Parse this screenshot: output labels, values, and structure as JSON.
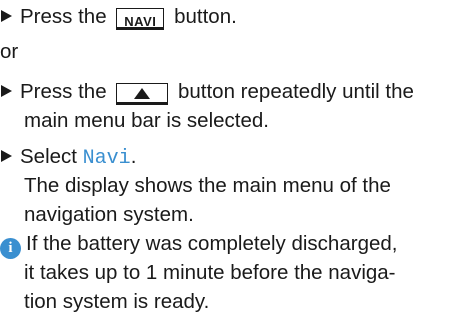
{
  "steps": {
    "step1": {
      "text_before": "Press the ",
      "key_label": "NAVI",
      "text_after": " button."
    },
    "or_label": "or",
    "step2": {
      "text_before": "Press the ",
      "key_symbol_name": "up-triangle-icon",
      "text_after": " button repeatedly until the",
      "line2": "main menu bar is selected."
    },
    "step3": {
      "text_before": "Select ",
      "menu_item": "Navi",
      "text_after": ".",
      "result_line1": "The display shows the main menu of the",
      "result_line2": "navigation system."
    }
  },
  "note": {
    "icon": "info-icon",
    "line1": "If the battery was completely discharged,",
    "line2": "it takes up to 1 minute before the naviga-",
    "line3": "tion system is ready."
  },
  "colors": {
    "accent": "#3a8fd0",
    "text": "#1a1a1a"
  }
}
